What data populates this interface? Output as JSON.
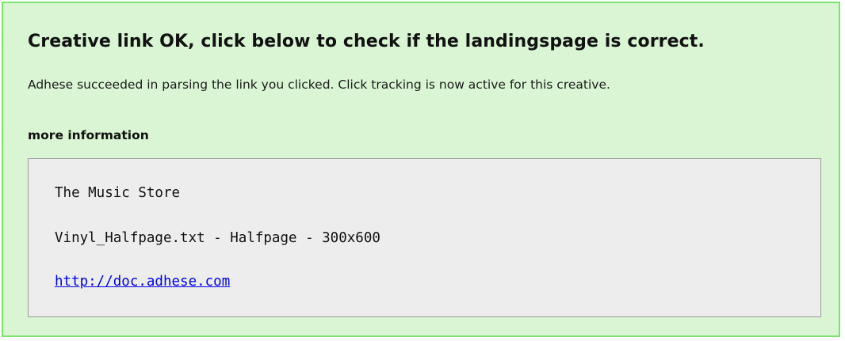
{
  "message": {
    "title": "Creative link OK, click below to check if the landingspage is correct.",
    "description": "Adhese succeeded in parsing the link you clicked. Click tracking is now active for this creative.",
    "more_info_label": "more information"
  },
  "info": {
    "advertiser": "The Music Store",
    "creative": "Vinyl_Halfpage.txt - Halfpage - 300x600",
    "link": "http://doc.adhese.com"
  },
  "colors": {
    "panel_background": "#d9f5d3",
    "panel_border": "#7ee36e",
    "info_background": "#ededed",
    "info_border": "#9a9a9a",
    "link": "#0000ee"
  }
}
